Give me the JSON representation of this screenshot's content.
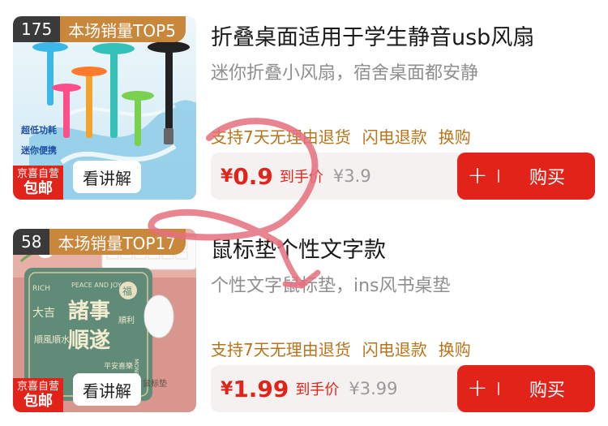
{
  "products": [
    {
      "rank_number": "175",
      "rank_label": "本场销量TOP5",
      "jd_top": "京喜自营",
      "jd_bottom": "包邮",
      "watch_label": "看讲解",
      "title": "折叠桌面适用于学生静音usb风扇",
      "subtitle": "迷你折叠小风扇，宿舍桌面都安静",
      "services": [
        "支持7天无理由退货",
        "闪电退款",
        "换购"
      ],
      "price_symbol": "¥",
      "price_value": "0.9",
      "price_label": "到手价",
      "original_price": "¥3.9",
      "plus_symbol": "+",
      "buy_label": "购买",
      "image_texts": [
        "超低功耗",
        "迷你便携"
      ]
    },
    {
      "rank_number": "58",
      "rank_label": "本场销量TOP17",
      "jd_top": "京喜自营",
      "jd_bottom": "包邮",
      "watch_label": "看讲解",
      "title": "鼠标垫个性文字款",
      "subtitle": "个性文字鼠标垫，ins风书桌垫",
      "services": [
        "支持7天无理由退货",
        "闪电退款",
        "换购"
      ],
      "price_symbol": "¥",
      "price_value": "1.99",
      "price_label": "到手价",
      "original_price": "¥3.99",
      "plus_symbol": "+",
      "buy_label": "购买",
      "image_texts": {
        "top_left": "RICH",
        "top_center": "PEACE AND JOY",
        "seal": "福",
        "left_big": "大吉",
        "main_top": "諸事",
        "main_bottom": "順遂",
        "side": "順利",
        "lower_left": "順風順水",
        "bottom_mark": "平安喜樂",
        "right_vertical": "MONEY",
        "bottom_text": "鼠标垫"
      }
    }
  ],
  "colors": {
    "accent_red": "#e2231a",
    "service_gold": "#b8741a",
    "rank_gold": "#c9873b",
    "rank_dark": "#3a3a3a",
    "doodle_pink": "#e5707c"
  }
}
